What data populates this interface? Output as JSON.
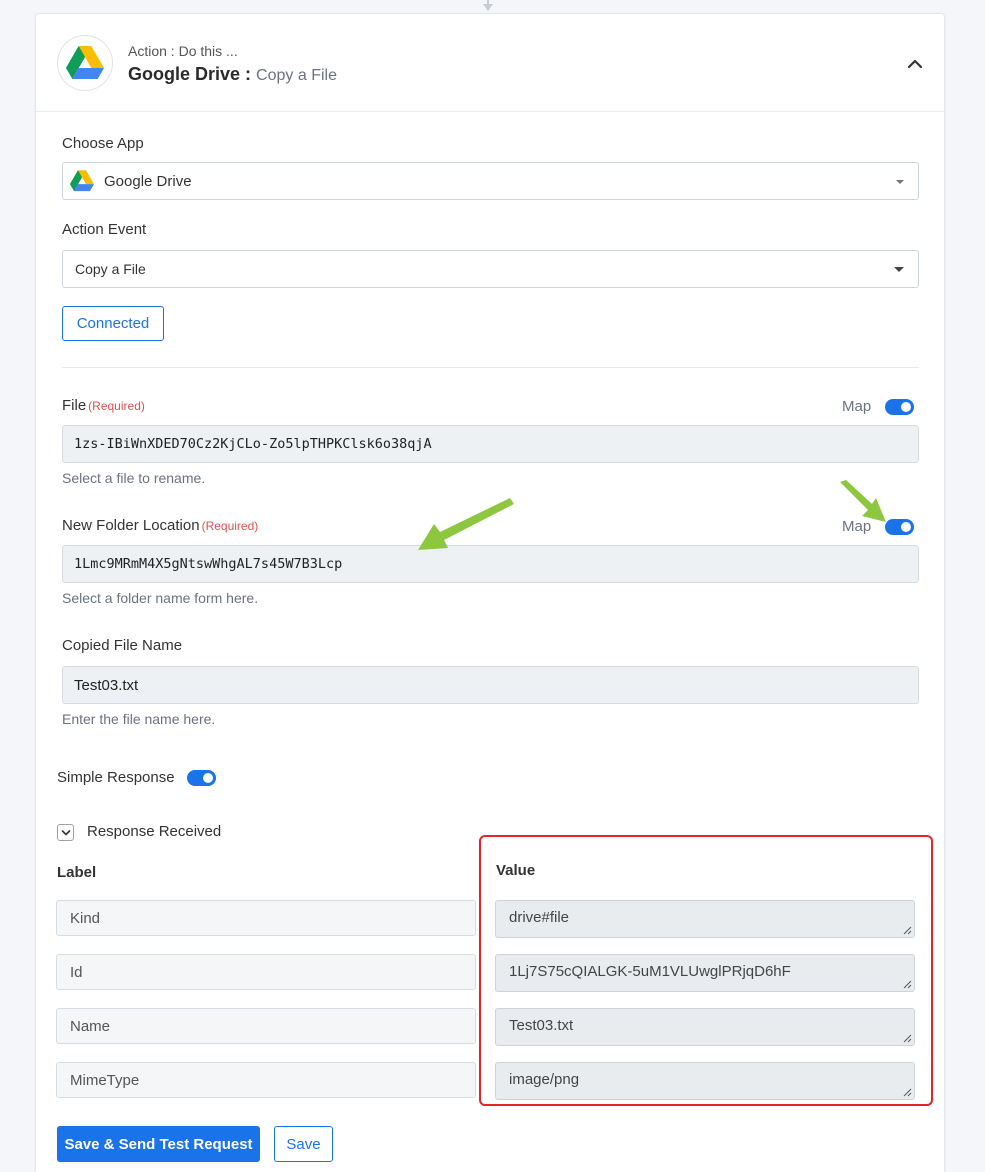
{
  "header": {
    "subtitle": "Action : Do this ...",
    "app_name": "Google Drive :",
    "event_name": "Copy a File"
  },
  "choose_app": {
    "label": "Choose App",
    "value": "Google Drive"
  },
  "action_event": {
    "label": "Action Event",
    "value": "Copy a File"
  },
  "connection": {
    "button_label": "Connected"
  },
  "fields": {
    "file": {
      "label": "File",
      "required": "(Required)",
      "map_label": "Map",
      "value": "1zs-IBiWnXDED70Cz2KjCLo-Zo5lpTHPKClsk6o38qjA",
      "help": "Select a file to rename."
    },
    "folder": {
      "label": "New Folder Location",
      "required": "(Required)",
      "map_label": "Map",
      "value": "1Lmc9MRmM4X5gNtswWhgAL7s45W7B3Lcp",
      "help": "Select a folder name form here."
    },
    "copied_name": {
      "label": "Copied File Name",
      "value": "Test03.txt",
      "help": "Enter the file name here."
    }
  },
  "simple_response": {
    "label": "Simple Response"
  },
  "response": {
    "title": "Response Received",
    "label_header": "Label",
    "value_header": "Value",
    "rows": [
      {
        "label": "Kind",
        "value": "drive#file"
      },
      {
        "label": "Id",
        "value": "1Lj7S75cQIALGK-5uM1VLUwglPRjqD6hF"
      },
      {
        "label": "Name",
        "value": "Test03.txt"
      },
      {
        "label": "MimeType",
        "value": "image/png"
      }
    ]
  },
  "footer": {
    "save_send_label": "Save & Send Test Request",
    "save_label": "Save"
  },
  "colors": {
    "accent": "#1a73e8",
    "highlight": "#e8222a",
    "annotation_arrow": "#8dc63f"
  }
}
